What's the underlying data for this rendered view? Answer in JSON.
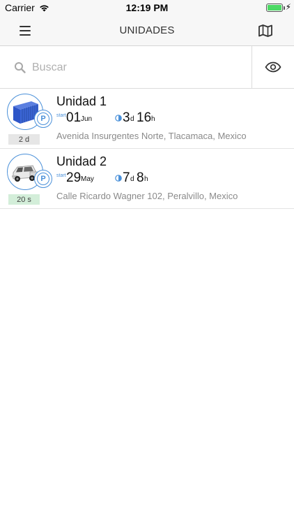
{
  "status_bar": {
    "carrier": "Carrier",
    "time": "12:19 PM"
  },
  "nav": {
    "title": "UNIDADES",
    "menu_icon": "hamburger-icon",
    "map_icon": "map-icon"
  },
  "search": {
    "placeholder": "Buscar",
    "value": "",
    "toggle_icon": "eye-icon"
  },
  "units": [
    {
      "name": "Unidad 1",
      "image": "container-image",
      "parking": "P",
      "age": "2 d",
      "age_color": "#e6e6e6",
      "start_label": "start",
      "start_day": "01",
      "start_month": "Jun",
      "duration_a": "3",
      "duration_a_unit": "d",
      "duration_b": "16",
      "duration_b_unit": "h",
      "address": "Avenida Insurgentes Norte, Tlacamaca, Mexico"
    },
    {
      "name": "Unidad 2",
      "image": "truck-image",
      "parking": "P",
      "age": "20 s",
      "age_color": "#d3eed9",
      "start_label": "start",
      "start_day": "29",
      "start_month": "May",
      "duration_a": "7",
      "duration_a_unit": "d",
      "duration_b": "8",
      "duration_b_unit": "h",
      "address": "Calle Ricardo Wagner 102, Peralvillo, Mexico"
    }
  ],
  "colors": {
    "accent": "#4a90d9",
    "battery": "#4cd964"
  }
}
